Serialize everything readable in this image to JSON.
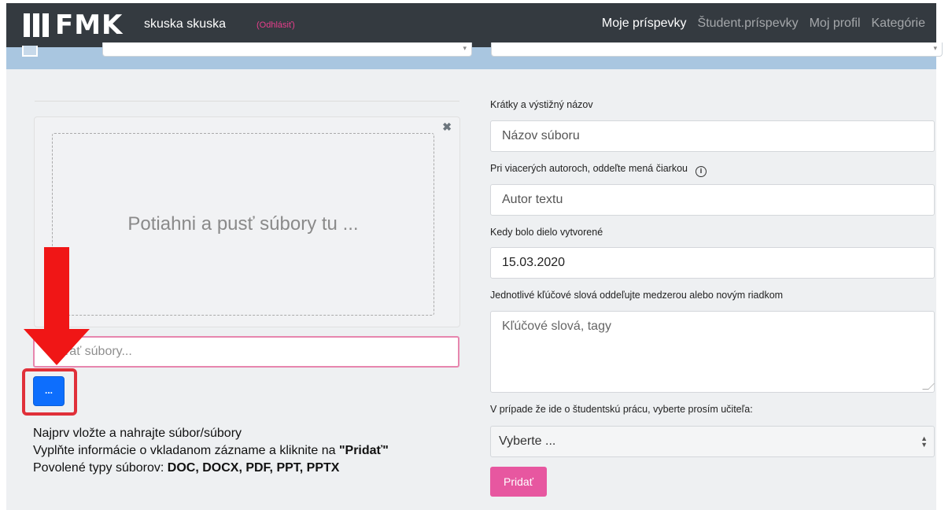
{
  "navbar": {
    "logo_text": "FMK",
    "user_name": "skuska skuska",
    "logout_label": "(Odhlásiť)",
    "links": [
      {
        "label": "Moje príspevky",
        "active": true
      },
      {
        "label": "Študent.príspevky",
        "active": false
      },
      {
        "label": "Moj profil",
        "active": false
      },
      {
        "label": "Kategórie",
        "active": false
      }
    ]
  },
  "upload": {
    "dropzone_text": "Potiahni a pusť súbory tu ...",
    "file_input_placeholder": "Vybrať súbory...",
    "browse_label": "...",
    "info_line1": "Najprv vložte a nahrajte súbor/súbory",
    "info_line2_prefix": "Vyplňte informácie o vkladanom zázname a kliknite na ",
    "info_line2_bold": "\"Pridať\"",
    "info_line3_prefix": "Povolené typy súborov: ",
    "info_line3_bold": "DOC, DOCX, PDF, PPT, PPTX"
  },
  "form": {
    "title_label": "Krátky a výstižný názov",
    "title_placeholder": "Názov súboru",
    "author_label": "Pri viacerých autoroch, oddeľte mená čiarkou",
    "author_placeholder": "Autor textu",
    "date_label": "Kedy bolo dielo vytvorené",
    "date_value": "15.03.2020",
    "keywords_label": "Jednotlivé kľúčové slová oddeľujte medzerou alebo novým riadkom",
    "keywords_placeholder": "Kľúčové slová, tagy",
    "teacher_label": "V prípade že ide o študentskú prácu, vyberte prosím učiteľa:",
    "teacher_selected": "Vyberte ...",
    "submit_label": "Pridať"
  },
  "colors": {
    "navbar": "#343a40",
    "accent_pink": "#e757a0",
    "primary_blue": "#0d6efd",
    "annotation_red": "#f01616"
  }
}
